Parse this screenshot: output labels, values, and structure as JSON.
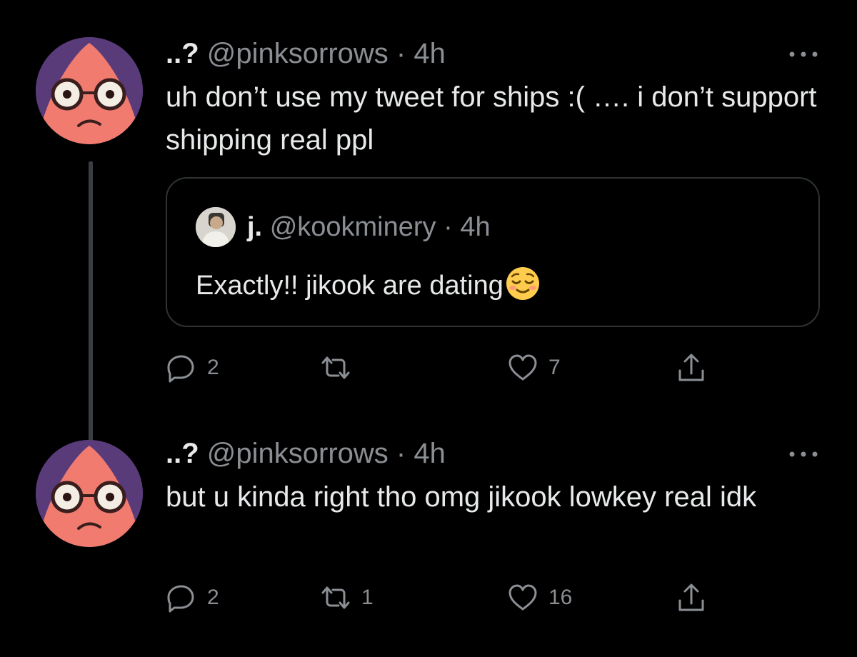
{
  "tweets": [
    {
      "display_name": "..?",
      "handle": "@pinksorrows",
      "separator": "·",
      "time": "4h",
      "text": "uh don’t use my tweet for ships :(  …. i don’t support shipping real ppl",
      "quote": {
        "display_name": "j.",
        "handle": "@kookminery",
        "separator": "·",
        "time": "4h",
        "text": "Exactly!! jikook are dating",
        "emoji": "relieved-face-emoji"
      },
      "actions": {
        "replies": "2",
        "retweets": "",
        "likes": "7"
      }
    },
    {
      "display_name": "..?",
      "handle": "@pinksorrows",
      "separator": "·",
      "time": "4h",
      "text": "but u kinda right tho omg jikook lowkey real idk",
      "actions": {
        "replies": "2",
        "retweets": "1",
        "likes": "16"
      }
    }
  ],
  "icons": {
    "more": "more-horizontal-icon",
    "reply": "reply-icon",
    "retweet": "retweet-icon",
    "like": "heart-icon",
    "share": "share-icon"
  },
  "colors": {
    "background": "#000000",
    "text": "#e7e9ea",
    "muted": "#8b8f94",
    "border": "#2f3336",
    "avatar_bg": "#5a3b7a",
    "avatar_face": "#f07b6e"
  }
}
